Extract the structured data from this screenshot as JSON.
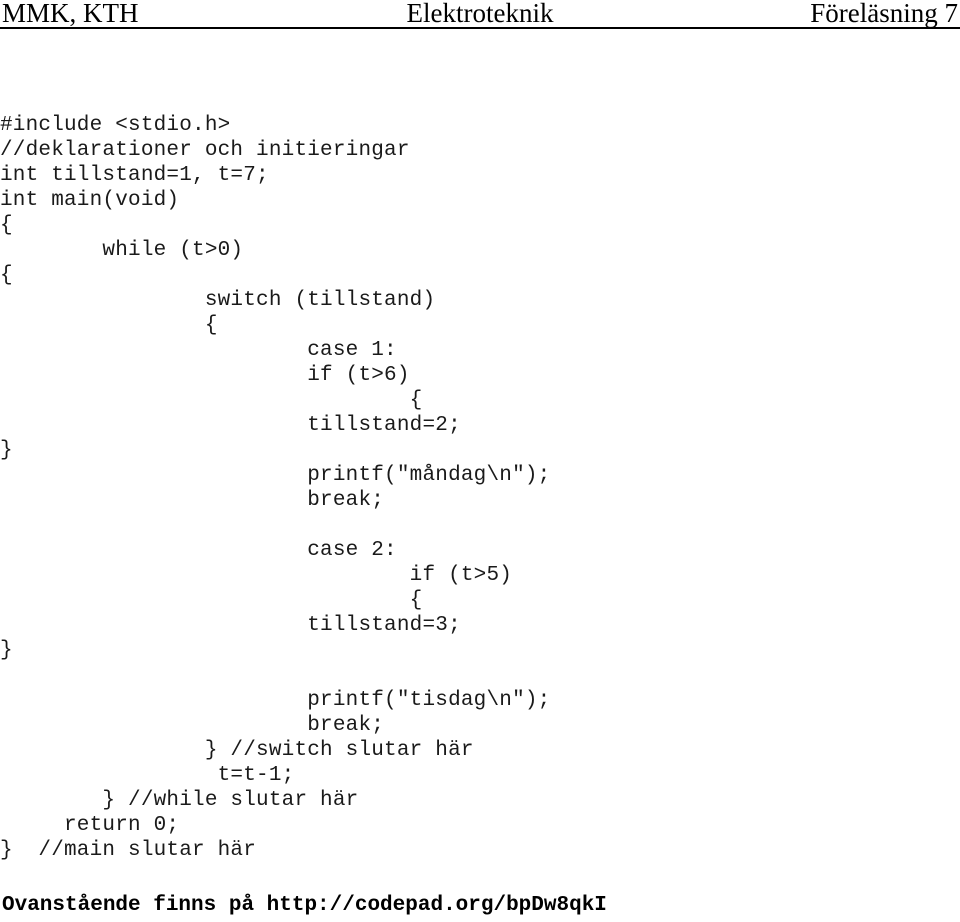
{
  "header": {
    "left": "MMK, KTH",
    "center": "Elektroteknik",
    "right": "Föreläsning 7",
    "rule_color": "#000000"
  },
  "code": {
    "language": "c",
    "lines": [
      "#include <stdio.h>",
      "//deklarationer och initieringar",
      "int tillstand=1, t=7;",
      "int main(void)",
      "{",
      "        while (t>0)",
      "{",
      "                switch (tillstand)",
      "                {",
      "                        case 1:",
      "                        if (t>6)",
      "                                {",
      "                        tillstand=2;",
      "}",
      "                        printf(\"måndag\\n\");",
      "                        break;",
      "",
      "                        case 2:",
      "                                if (t>5)",
      "                                {",
      "                        tillstand=3;",
      "}",
      "",
      "                        printf(\"tisdag\\n\");",
      "                        break;",
      "                } //switch slutar här",
      "                 t=t-1;",
      "        } //while slutar här",
      "     return 0;",
      "}  //main slutar här"
    ]
  },
  "footer": {
    "text": "Ovanstående finns på http://codepad.org/bpDw8qkI",
    "url": "http://codepad.org/bpDw8qkI"
  }
}
